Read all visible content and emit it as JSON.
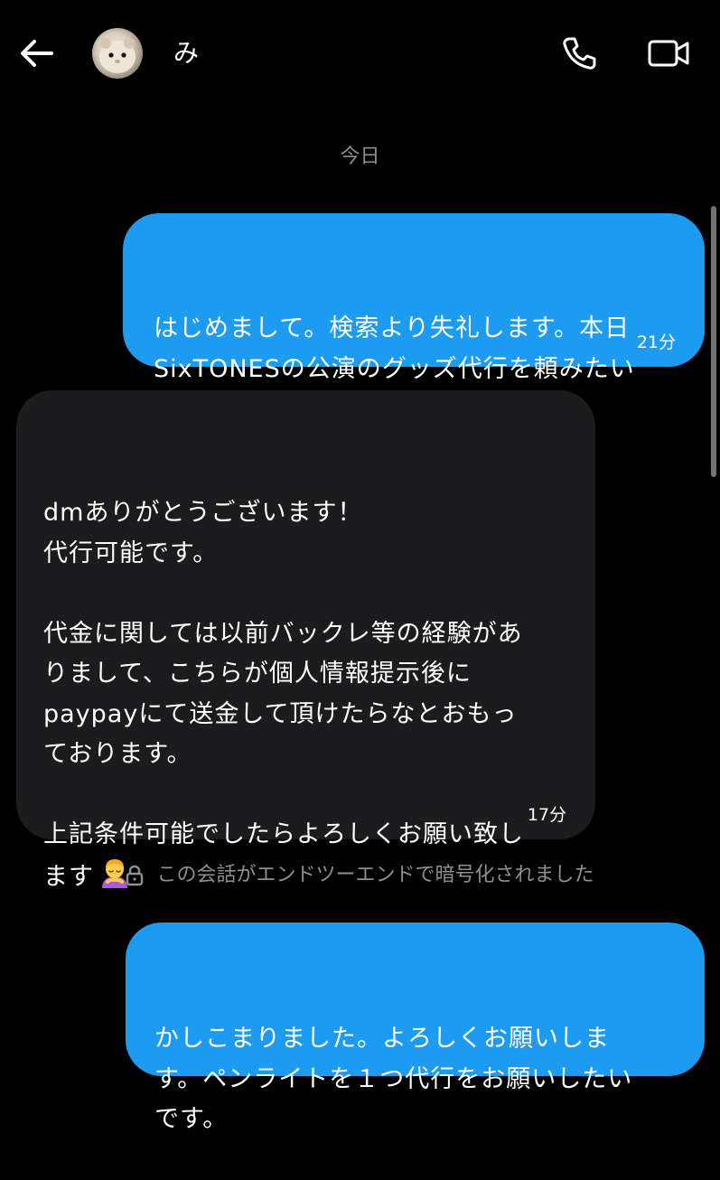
{
  "header": {
    "contact_name": "み",
    "back_icon": "arrow-left-icon",
    "call_icon": "phone-icon",
    "video_icon": "video-camera-icon"
  },
  "date_separator": "今日",
  "messages": [
    {
      "direction": "outgoing",
      "text": "はじめまして。検索より失礼します。本日\nSixTONESの公演のグッズ代行を頼みたい\nのですがまだ可能でしょうか？",
      "time": "21分"
    },
    {
      "direction": "incoming",
      "text": "dmありがとうございます！\n代行可能です。\n\n代金に関しては以前バックレ等の経験があ\nりまして、こちらが個人情報提示後に\npaypayにて送金して頂けたらなとおもっ\nております。\n\n上記条件可能でしたらよろしくお願い致し\nます",
      "emoji": "person-bowing-emoji",
      "time": "17分"
    },
    {
      "direction": "outgoing",
      "text": "かしこまりました。よろしくお願いしま\nす。ペンライトを１つ代行をお願いしたい\nです。",
      "time": ""
    }
  ],
  "encryption_notice": "この会話がエンドツーエンドで暗号化されました",
  "colors": {
    "background": "#000000",
    "outgoing_bubble": "#1d9bf0",
    "incoming_bubble": "#1c1c1e",
    "secondary_text": "#8e8e93"
  }
}
